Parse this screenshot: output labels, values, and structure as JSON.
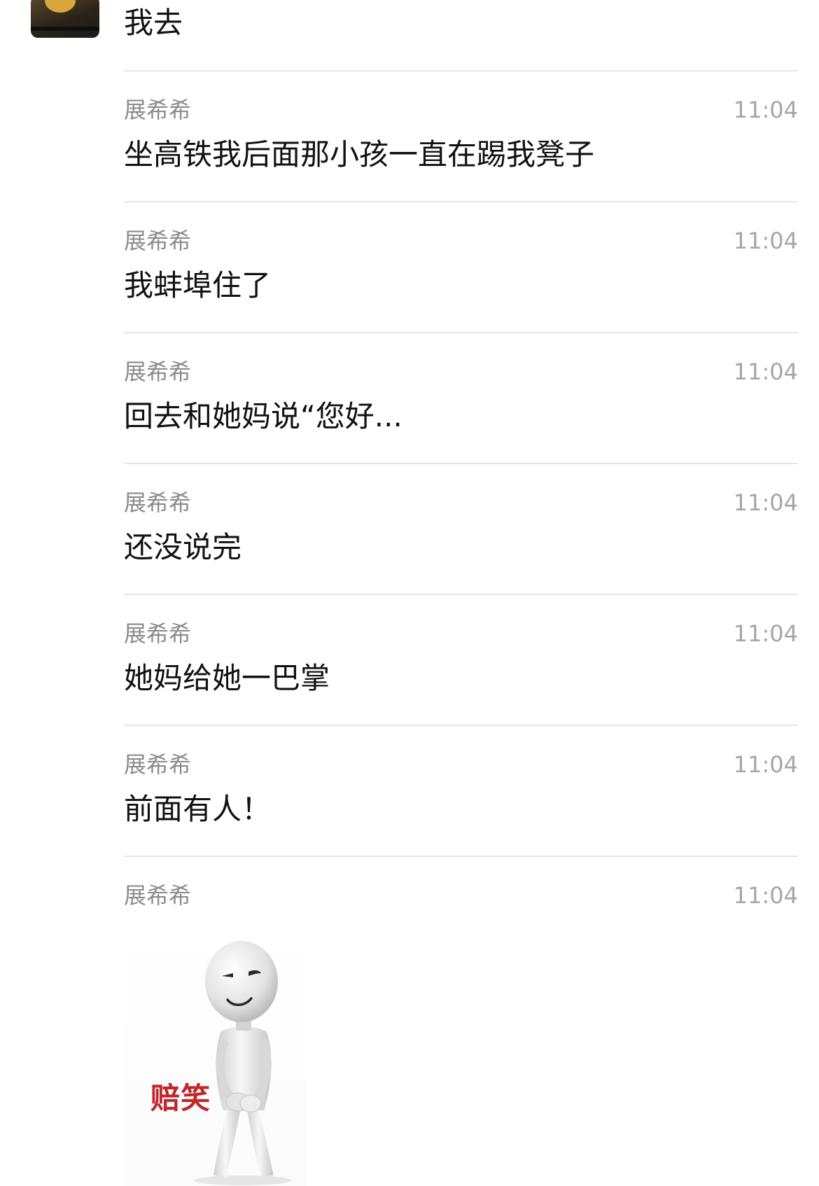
{
  "first_message": {
    "text": "我去"
  },
  "messages": [
    {
      "sender": "展希希",
      "time": "11:04",
      "text": "坐高铁我后面那小孩一直在踢我凳子"
    },
    {
      "sender": "展希希",
      "time": "11:04",
      "text": "我蚌埠住了"
    },
    {
      "sender": "展希希",
      "time": "11:04",
      "text": "回去和她妈说“您好..."
    },
    {
      "sender": "展希希",
      "time": "11:04",
      "text": "还没说完"
    },
    {
      "sender": "展希希",
      "time": "11:04",
      "text": "她妈给她一巴掌"
    },
    {
      "sender": "展希希",
      "time": "11:04",
      "text": "前面有人！"
    },
    {
      "sender": "展希希",
      "time": "11:04",
      "sticker_caption": "赔笑"
    }
  ]
}
